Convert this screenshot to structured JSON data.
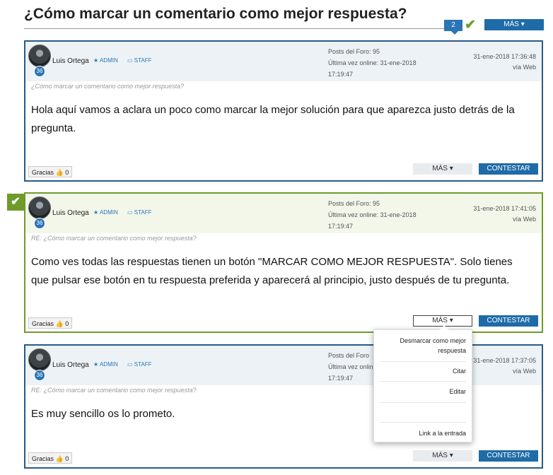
{
  "page": {
    "title": "¿Cómo marcar un comentario como mejor respuesta?",
    "reply_count": "2",
    "more_button": "MÁS ▾"
  },
  "posts": [
    {
      "author": "Luis Ortega",
      "level": "36",
      "role_admin": "★ ADMIN",
      "role_staff": "▭ STAFF",
      "forum_posts": "Posts del Foro: 95",
      "last_online": "Última vez online: 31-ene-2018",
      "last_online_time": "17:19:47",
      "date": "31-ene-2018 17:36:48",
      "via": "vía Web",
      "quote": "¿Cómo marcar un comentario como mejor respuesta?",
      "body": "Hola aquí vamos a aclara un poco como marcar la mejor solución para que aparezca justo detrás de la pregunta.",
      "thanks": "Gracias 👍 0",
      "more": "MÁS ▾",
      "reply": "CONTESTAR"
    },
    {
      "author": "Luis Ortega",
      "level": "36",
      "role_admin": "★ ADMIN",
      "role_staff": "▭ STAFF",
      "forum_posts": "Posts del Foro: 95",
      "last_online": "Última vez online: 31-ene-2018",
      "last_online_time": "17:19:47",
      "date": "31-ene-2018 17:41:05",
      "via": "vía Web",
      "quote": "RE: ¿Cómo marcar un comentario como mejor respuesta?",
      "body": "Como ves todas las respuestas tienen un botón \"MARCAR COMO MEJOR RESPUESTA\". Solo tienes que pulsar ese botón en tu respuesta preferida y aparecerá al principio, justo después de tu pregunta.",
      "thanks": "Gracias 👍 0",
      "more": "MÁS ▾",
      "reply": "CONTESTAR"
    },
    {
      "author": "Luis Ortega",
      "level": "36",
      "role_admin": "★ ADMIN",
      "role_staff": "▭ STAFF",
      "forum_posts": "Posts del Foro",
      "last_online": "Última vez onlin",
      "last_online_time": "17:19:47",
      "date": "31-ene-2018 17:37:05",
      "via": "vía Web",
      "quote": "RE: ¿Cómo marcar un comentario como mejor respuesta?",
      "body": "Es muy sencillo os lo prometo.",
      "thanks": "Gracias 👍 0",
      "more": "MÁS ▾",
      "reply": "CONTESTAR"
    }
  ],
  "dropdown": {
    "items": [
      "Desmarcar como mejor respuesta",
      "Citar",
      "Editar",
      "",
      "Link a la entrada"
    ]
  },
  "colors": {
    "accent": "#1e6ba8",
    "best_answer": "#6e9b2a"
  },
  "icons": {
    "check": "check-icon",
    "star": "star-icon",
    "thumbs_up": "thumbs-up-icon"
  }
}
